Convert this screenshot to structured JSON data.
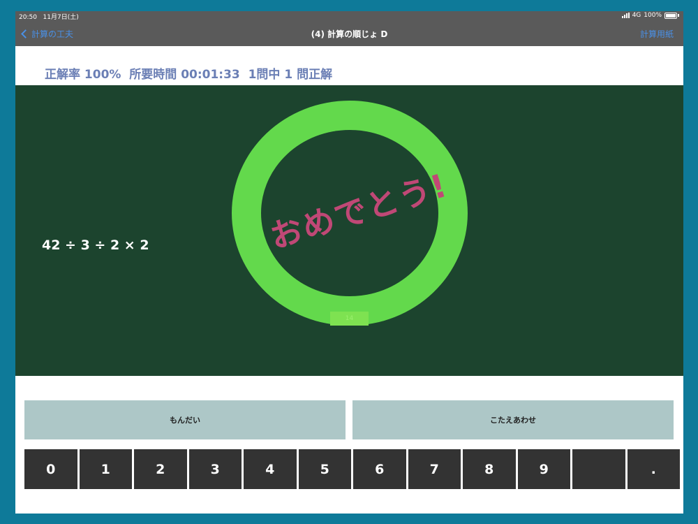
{
  "status": {
    "time": "20:50",
    "date": "11月7日(土)",
    "network": "4G",
    "battery": "100%"
  },
  "nav": {
    "back_label": "計算の工夫",
    "title": "(4) 計算の順じょ D",
    "right_label": "計算用紙"
  },
  "stats": {
    "text": "正解率 100%  所要時間 00:01:33  1問中 1 問正解"
  },
  "board": {
    "problem": "42 ÷ 3 ÷ 2 × 2",
    "congrats": "おめでとう!",
    "answer": "14"
  },
  "actions": {
    "question_label": "もんだい",
    "check_label": "こたえあわせ"
  },
  "keypad": {
    "keys": [
      "0",
      "1",
      "2",
      "3",
      "4",
      "5",
      "6",
      "7",
      "8",
      "9",
      "",
      "."
    ]
  },
  "colors": {
    "board": "#1c442e",
    "ring": "#63d94c",
    "congrats": "#c04876",
    "accent": "#4a90e6",
    "stats": "#6b7fb5"
  }
}
